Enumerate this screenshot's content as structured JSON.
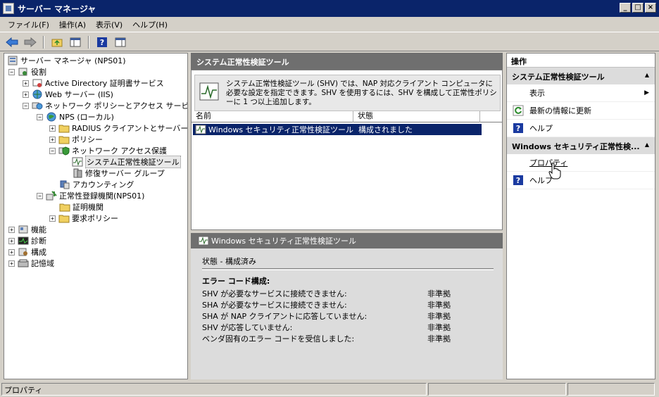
{
  "window": {
    "title": "サーバー マネージャ",
    "min": "_",
    "max": "□",
    "close": "×"
  },
  "menu": [
    "ファイル(F)",
    "操作(A)",
    "表示(V)",
    "ヘルプ(H)"
  ],
  "tree": [
    {
      "label": "サーバー マネージャ (NPS01)",
      "exp": ""
    },
    {
      "label": "役割",
      "exp": "−"
    },
    {
      "label": "Active Directory 証明書サービス",
      "exp": "+"
    },
    {
      "label": "Web サーバー (IIS)",
      "exp": "+"
    },
    {
      "label": "ネットワーク ポリシーとアクセス サービス",
      "exp": "−"
    },
    {
      "label": "NPS (ローカル)",
      "exp": "−"
    },
    {
      "label": "RADIUS クライアントとサーバー",
      "exp": "+"
    },
    {
      "label": "ポリシー",
      "exp": "+"
    },
    {
      "label": "ネットワーク アクセス保護",
      "exp": "−"
    },
    {
      "label": "システム正常性検証ツール",
      "exp": ""
    },
    {
      "label": "修復サーバー グループ",
      "exp": ""
    },
    {
      "label": "アカウンティング",
      "exp": ""
    },
    {
      "label": "正常性登録機関(NPS01)",
      "exp": "−"
    },
    {
      "label": "証明機関",
      "exp": ""
    },
    {
      "label": "要求ポリシー",
      "exp": "+"
    },
    {
      "label": "機能",
      "exp": "+"
    },
    {
      "label": "診断",
      "exp": "+"
    },
    {
      "label": "構成",
      "exp": "+"
    },
    {
      "label": "記憶域",
      "exp": "+"
    }
  ],
  "center": {
    "title": "システム正常性検証ツール",
    "description": "システム正常性検証ツール (SHV) では、NAP 対応クライアント コンピュータに必要な設定を指定できます。SHV を使用するには、SHV を構成して正常性ポリシーに 1 つ以上追加します。",
    "columns": [
      "名前",
      "状態"
    ],
    "rows": [
      {
        "name": "Windows セキュリティ正常性検証ツール",
        "status": "構成されました"
      }
    ]
  },
  "detail": {
    "title": "Windows セキュリティ正常性検証ツール",
    "state": "状態 - 構成済み",
    "error_title": "エラー コード構成:",
    "errors": [
      {
        "name": "SHV が必要なサービスに接続できません:",
        "value": "非準拠"
      },
      {
        "name": "SHA が必要なサービスに接続できません:",
        "value": "非準拠"
      },
      {
        "name": "SHA が NAP クライアントに応答していません:",
        "value": "非準拠"
      },
      {
        "name": "SHV が応答していません:",
        "value": "非準拠"
      },
      {
        "name": "ベンダ固有のエラー コードを受信しました:",
        "value": "非準拠"
      }
    ]
  },
  "actions": {
    "title": "操作",
    "group1": {
      "title": "システム正常性検証ツール",
      "items": [
        "表示",
        "最新の情報に更新",
        "ヘルプ"
      ]
    },
    "group2": {
      "title": "Windows セキュリティ正常性検...",
      "items": [
        "プロパティ",
        "ヘルプ"
      ]
    }
  },
  "status": {
    "text": "プロパティ"
  },
  "colors": {
    "title_bar": "#0a246a",
    "header": "#6f6f6f",
    "selection": "#0a246a"
  }
}
